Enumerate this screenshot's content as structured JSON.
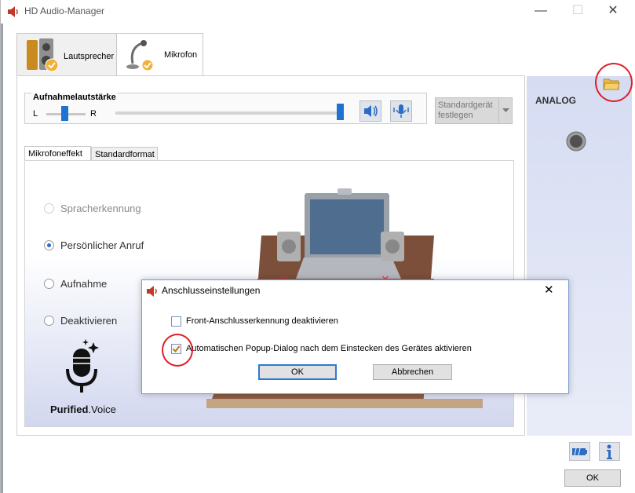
{
  "window": {
    "title": "HD Audio-Manager",
    "minimize": "—",
    "maximize": "☐",
    "close": "✕"
  },
  "tabs": [
    {
      "label": "Lautsprecher"
    },
    {
      "label": "Mikrofon"
    }
  ],
  "recording": {
    "title": "Aufnahmelautstärke",
    "left": "L",
    "right": "R",
    "default_device": "Standardgerät festlegen"
  },
  "subtabs": [
    {
      "label": "Mikrofoneffekt"
    },
    {
      "label": "Standardformat"
    }
  ],
  "effects": [
    {
      "label": "Spracherkennung",
      "state": "disabled"
    },
    {
      "label": "Persönlicher Anruf",
      "state": "checked"
    },
    {
      "label": "Aufnahme",
      "state": "unchecked"
    },
    {
      "label": "Deaktivieren",
      "state": "unchecked"
    }
  ],
  "brand": {
    "bold": "Purified",
    "regular": ".Voice"
  },
  "right_panel": {
    "label": "ANALOG"
  },
  "dialog": {
    "title": "Anschlusseinstellungen",
    "close": "✕",
    "options": [
      {
        "label": "Front-Anschlusserkennung deaktivieren",
        "checked": false
      },
      {
        "label": "Automatischen Popup-Dialog nach dem Einstecken des Gerätes aktivieren",
        "checked": true
      }
    ],
    "ok": "OK",
    "cancel": "Abbrechen"
  },
  "footer": {
    "ok": "OK"
  },
  "colors": {
    "accent": "#2b6cc4",
    "annotation": "#e0202a",
    "panel_gradient_top": "#d6dcf2"
  }
}
